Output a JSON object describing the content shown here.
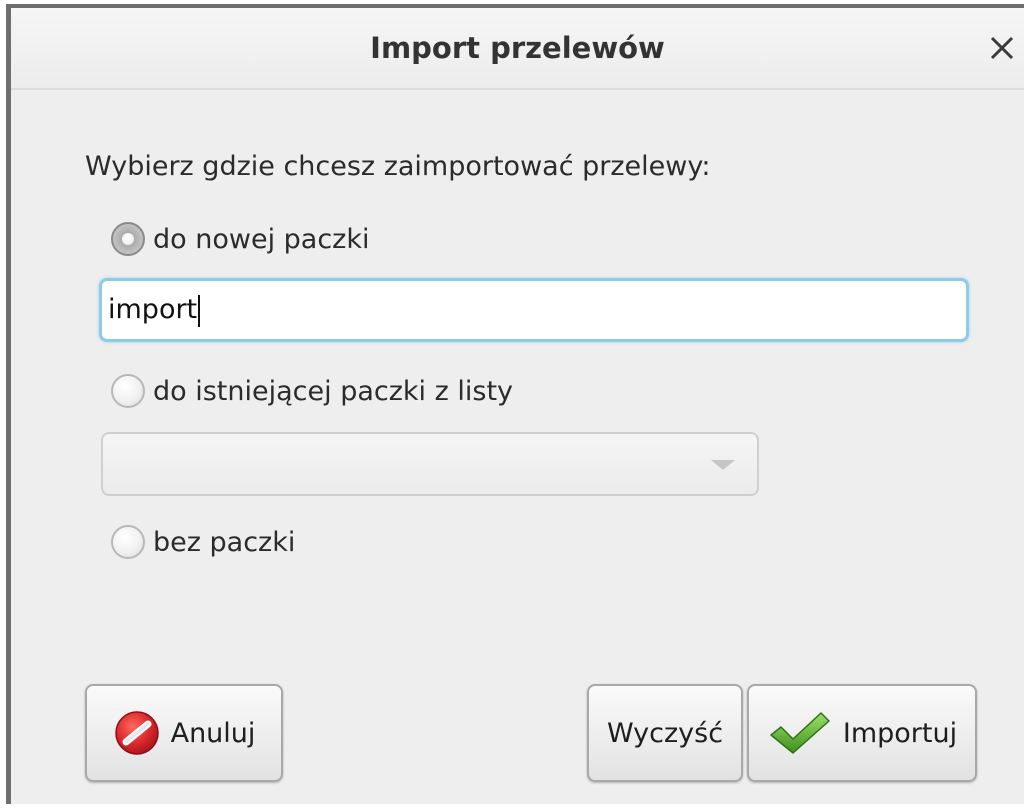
{
  "window": {
    "title": "Import przelewów",
    "close_icon": "close-icon"
  },
  "form": {
    "prompt": "Wybierz gdzie chcesz zaimportować przelewy:",
    "options": [
      {
        "label": "do nowej paczki",
        "checked": true
      },
      {
        "label": "do istniejącej paczki z listy",
        "checked": false
      },
      {
        "label": "bez paczki",
        "checked": false
      }
    ],
    "new_package_name": "import",
    "existing_package_select": {
      "selected": "",
      "icon": "chevron-down-icon"
    }
  },
  "buttons": {
    "cancel": {
      "label": "Anuluj",
      "icon": "cancel-icon"
    },
    "clear": {
      "label": "Wyczyść"
    },
    "import": {
      "label": "Importuj",
      "icon": "checkmark-icon"
    }
  },
  "colors": {
    "accent_input_border": "#8fcbe8",
    "cancel_red": "#d9262c",
    "check_green": "#5cae2a"
  }
}
